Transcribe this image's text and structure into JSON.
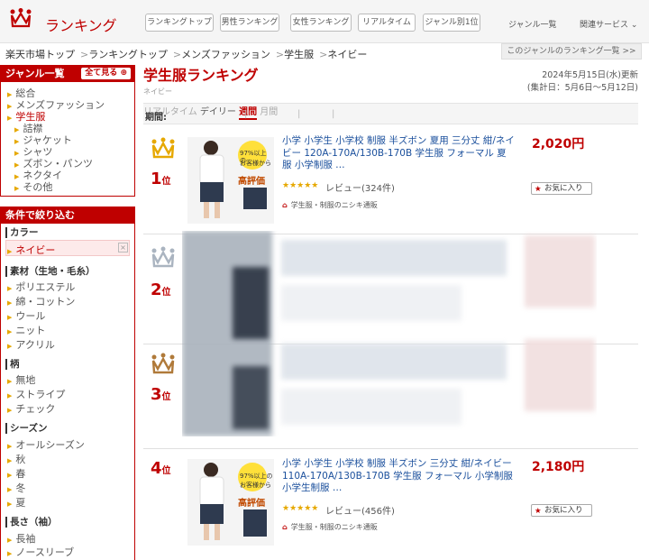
{
  "header": {
    "logo_text": "ランキング",
    "tabs": [
      "ランキングトップ",
      "男性ランキング",
      "女性ランキング",
      "リアルタイム",
      "ジャンル別1位"
    ],
    "links": [
      "ジャンル一覧",
      "関連サービス"
    ]
  },
  "breadcrumb": [
    "楽天市場トップ",
    "ランキングトップ",
    "メンズファッション",
    "学生服",
    "ネイビー"
  ],
  "genre_list_button": "このジャンルのランキング一覧 >>",
  "sidebar": {
    "genre_head": "ジャンル一覧",
    "show_all": "全て見る",
    "genres": [
      "総合",
      "メンズファッション",
      "学生服"
    ],
    "sub_genres": [
      "詰襟",
      "ジャケット",
      "シャツ",
      "ズボン・パンツ",
      "ネクタイ",
      "その他"
    ],
    "filter_head": "条件で絞り込む",
    "groups": [
      {
        "label": "カラー",
        "items": [
          "ネイビー"
        ]
      },
      {
        "label": "素材（生地・毛糸）",
        "items": [
          "ポリエステル",
          "綿・コットン",
          "ウール",
          "ニット",
          "アクリル"
        ]
      },
      {
        "label": "柄",
        "items": [
          "無地",
          "ストライプ",
          "チェック"
        ]
      },
      {
        "label": "シーズン",
        "items": [
          "オールシーズン",
          "秋",
          "春",
          "冬",
          "夏"
        ]
      },
      {
        "label": "長さ（袖）",
        "items": [
          "長袖",
          "ノースリーブ"
        ]
      }
    ],
    "clear_symbol": "×"
  },
  "main": {
    "title": "学生服ランキング",
    "subtitle": "ネイビー",
    "date_updated": "2024年5月15日(水)更新",
    "date_range": "(集計日：5月6日〜5月12日)",
    "period_label": "期間:",
    "periods": [
      "リアルタイム",
      "デイリー",
      "週間",
      "月間"
    ],
    "active_period": "週間"
  },
  "rankings": [
    {
      "rank": "1",
      "rank_suffix": "位",
      "title": "小学 小学生 小学校 制服 半ズボン 夏用 三分丈 紺/ネイビー 120A-170A/130B-170B 学生服 フォーマル 夏服 小学制服 …",
      "price": "2,020円",
      "stars": "★★★★★",
      "review": "レビュー(324件)",
      "shop": "学生服・制服のニシキ通販",
      "fav": "お気に入り",
      "badge_line1": "97%以上の",
      "badge_line2": "お客様から",
      "badge_line3": "高評価"
    },
    {
      "rank": "2",
      "rank_suffix": "位"
    },
    {
      "rank": "3",
      "rank_suffix": "位"
    },
    {
      "rank": "4",
      "rank_suffix": "位",
      "title": "小学 小学生 小学校 制服 半ズボン 三分丈 紺/ネイビー 110A-170A/130B-170B 学生服 フォーマル 小学制服 小学生制服 …",
      "price": "2,180円",
      "stars": "★★★★★",
      "review": "レビュー(456件)",
      "shop": "学生服・制服のニシキ通販",
      "fav": "お気に入り",
      "badge_line1": "97%以上の",
      "badge_line2": "お客様から",
      "badge_line3": "高評価"
    }
  ],
  "colors": {
    "brand": "#bf0000",
    "link": "#1a4f9c",
    "gold": "#e6a800",
    "silver": "#aab4c0",
    "bronze": "#b07a3a"
  }
}
